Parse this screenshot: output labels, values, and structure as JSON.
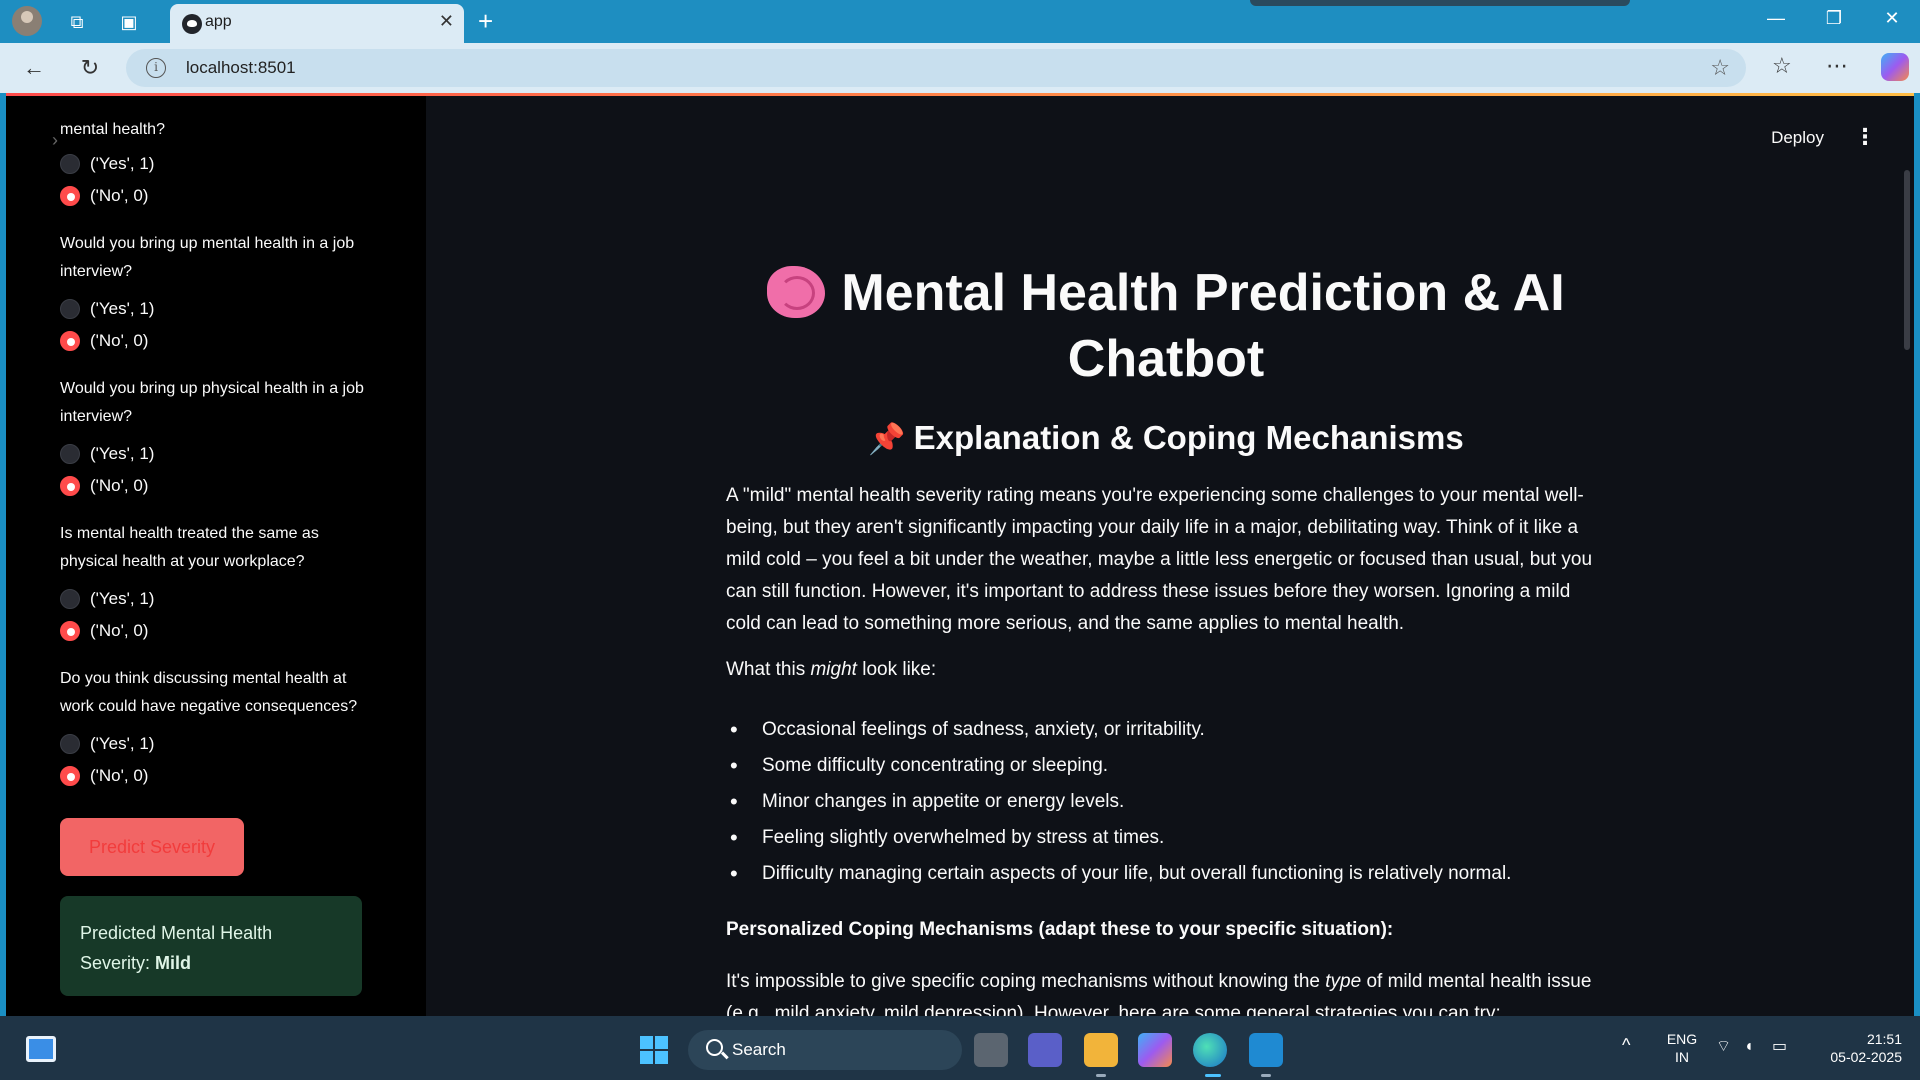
{
  "browser": {
    "tab_title": "app",
    "tab_close": "✕",
    "new_tab": "+",
    "url": "localhost:8501",
    "window_controls": [
      "—",
      "❐",
      "✕"
    ]
  },
  "header": {
    "deploy_label": "Deploy",
    "menu_icon": "⋮"
  },
  "sidebar": {
    "partial_question": "mental health?",
    "q1_radio_yes": "('Yes', 1)",
    "q1_radio_no": "('No', 0)",
    "q2": "Would you bring up mental health in a job interview?",
    "q2_yes": "('Yes', 1)",
    "q2_no": "('No', 0)",
    "q3": "Would you bring up physical health in a job interview?",
    "q3_yes": "('Yes', 1)",
    "q3_no": "('No', 0)",
    "q4": "Is mental health treated the same as physical health at your workplace?",
    "q4_yes": "('Yes', 1)",
    "q4_no": "('No', 0)",
    "q5": "Do you think discussing mental health at work could have negative consequences?",
    "q5_yes": "('Yes', 1)",
    "q5_no": "('No', 0)",
    "predict_button": "Predict Severity",
    "result_prefix": "Predicted Mental Health Severity: ",
    "result_value": "Mild"
  },
  "main": {
    "title": "Mental Health Prediction & AI Chatbot",
    "subtitle": "Explanation & Coping Mechanisms",
    "para1": "A \"mild\" mental health severity rating means you're experiencing some challenges to your mental well-being, but they aren't significantly impacting your daily life in a major, debilitating way. Think of it like a mild cold – you feel a bit under the weather, maybe a little less energetic or focused than usual, but you can still function. However, it's important to address these issues before they worsen. Ignoring a mild cold can lead to something more serious, and the same applies to mental health.",
    "para2_prefix": "What this ",
    "para2_em": "might",
    "para2_suffix": " look like:",
    "bullets": [
      "Occasional feelings of sadness, anxiety, or irritability.",
      "Some difficulty concentrating or sleeping.",
      "Minor changes in appetite or energy levels.",
      "Feeling slightly overwhelmed by stress at times.",
      "Difficulty managing certain aspects of your life, but overall functioning is relatively normal."
    ],
    "coping_heading": "Personalized Coping Mechanisms (adapt these to your specific situation):",
    "para3_prefix": "It's impossible to give specific coping mechanisms without knowing the ",
    "para3_em": "type",
    "para3_suffix": " of mild mental health issue (e.g., mild anxiety, mild depression). However, here are some general strategies you can try:"
  },
  "taskbar": {
    "search_label": "Search",
    "lang_line1": "ENG",
    "lang_line2": "IN",
    "time": "21:51",
    "date": "05-02-2025"
  }
}
